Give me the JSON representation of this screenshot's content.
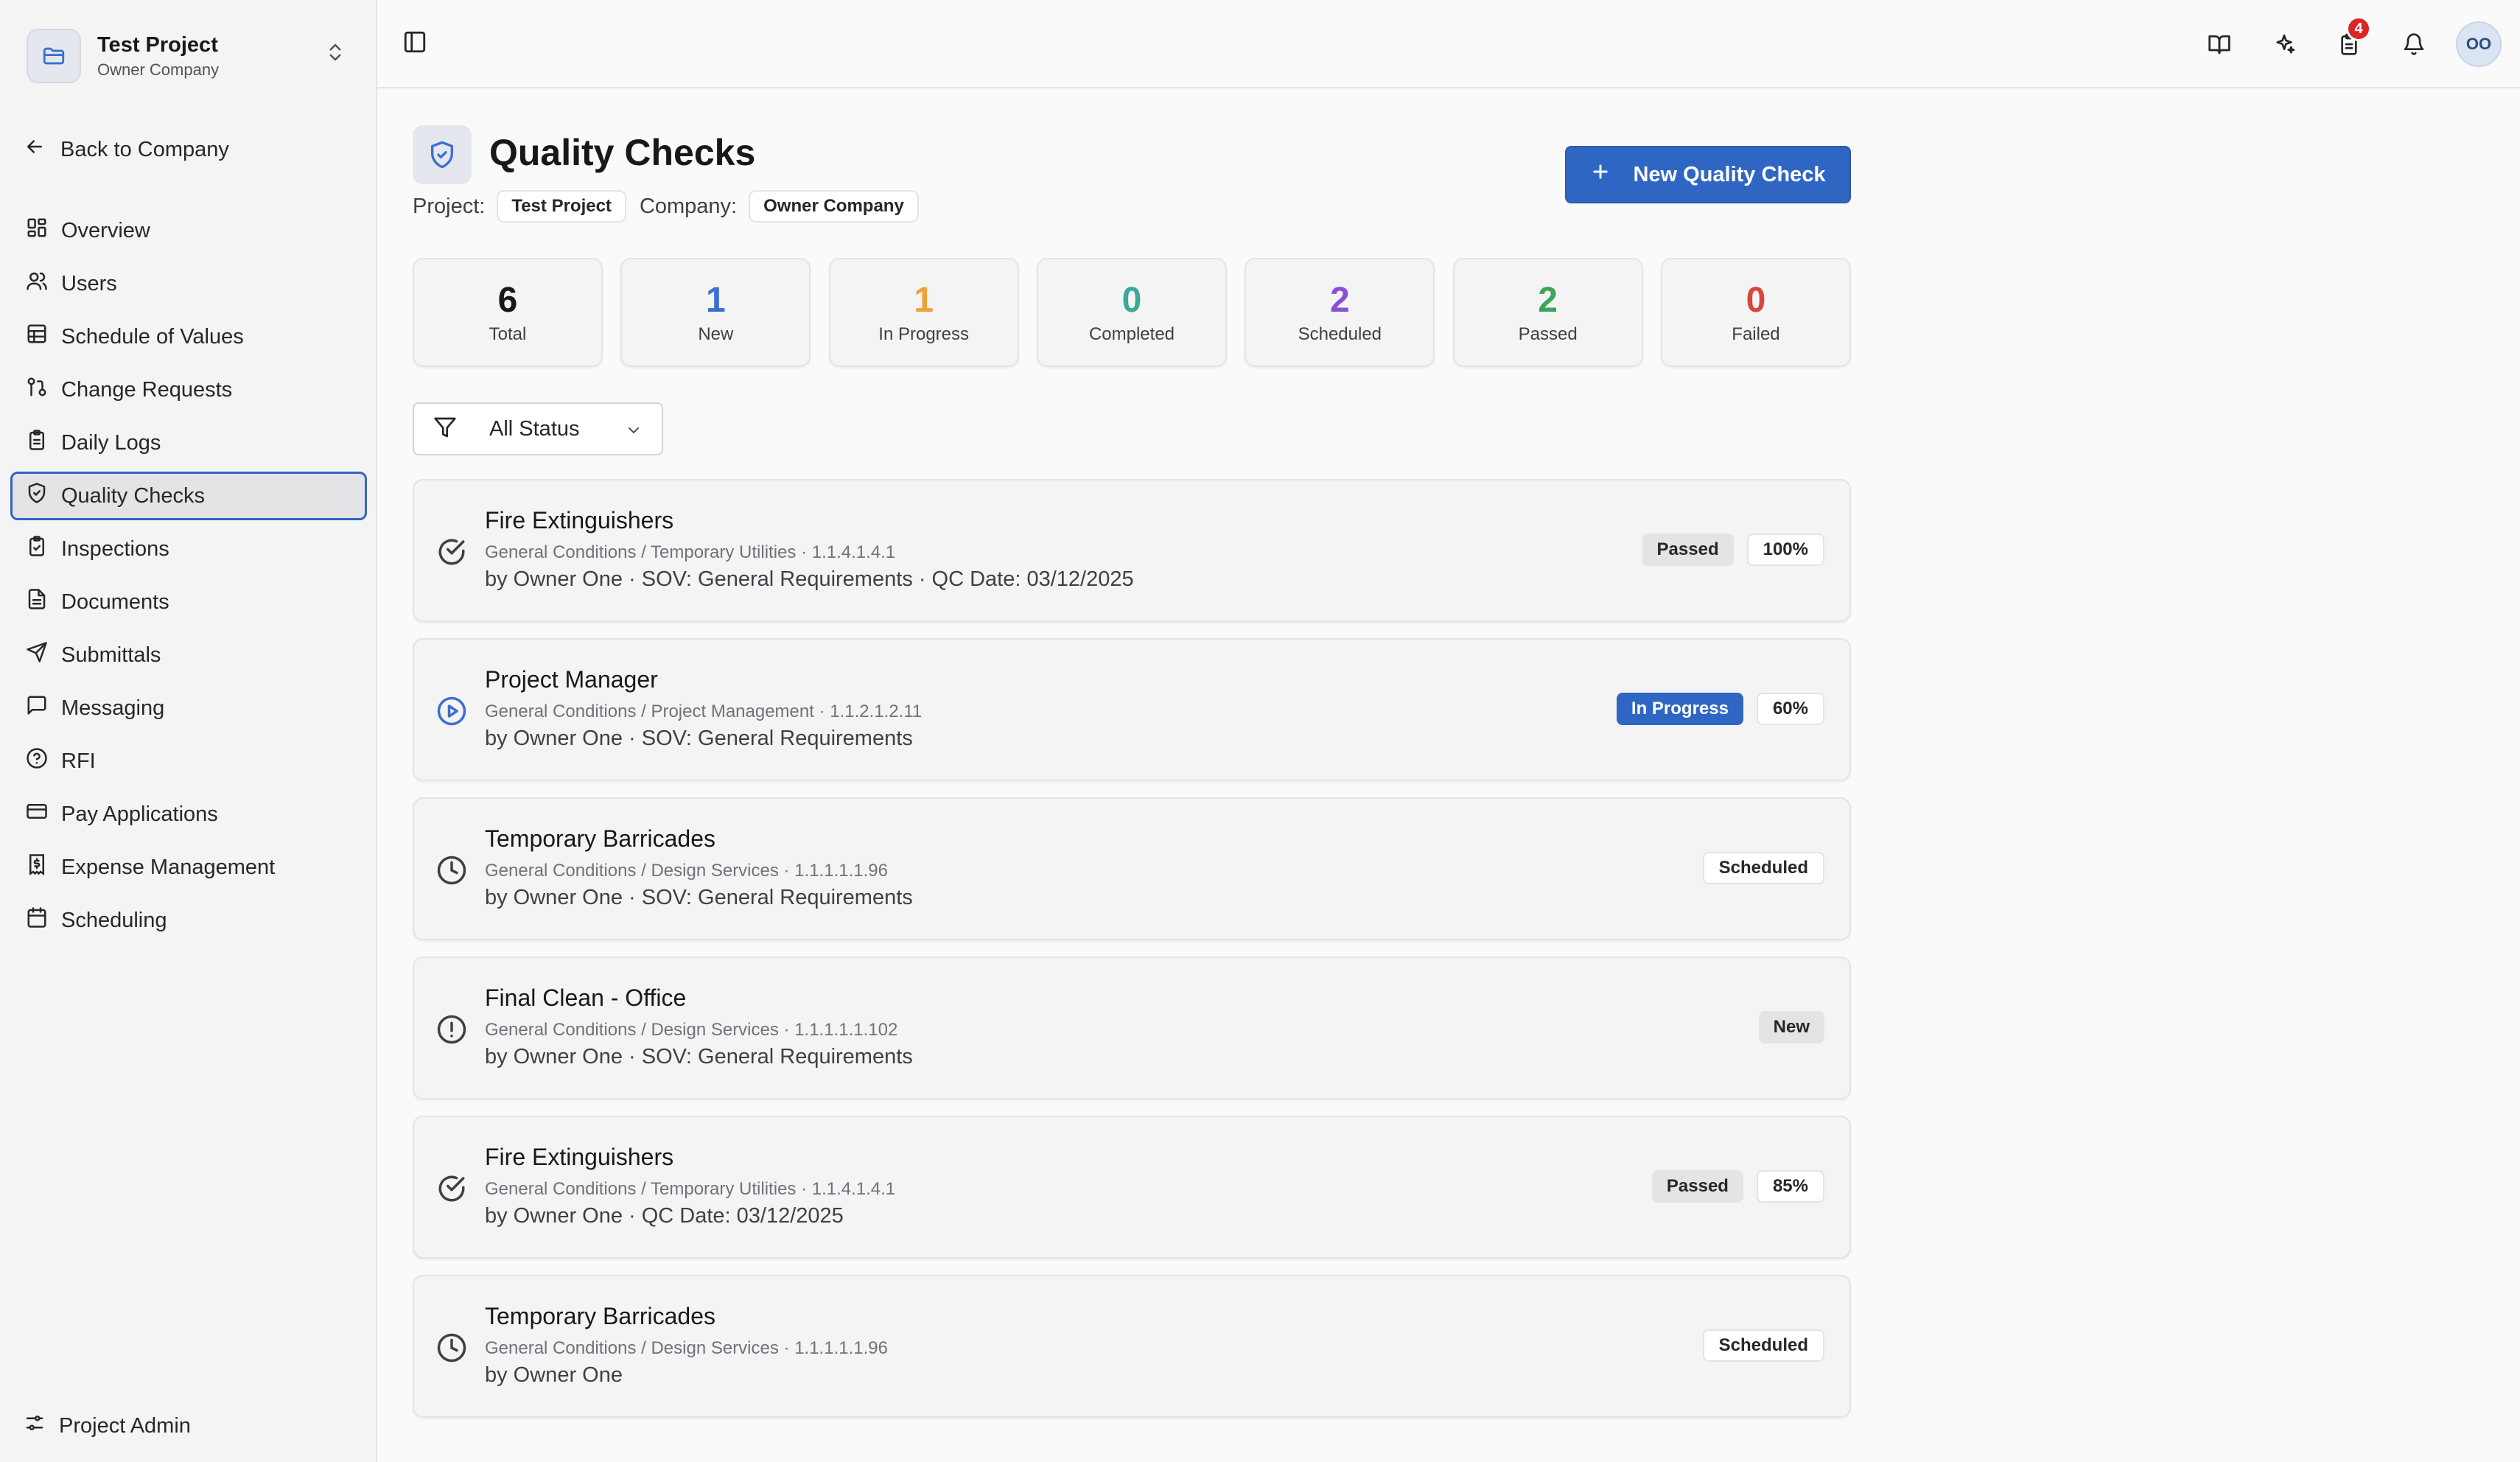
{
  "project": {
    "name": "Test Project",
    "company": "Owner Company"
  },
  "sidebar": {
    "back_label": "Back to Company",
    "items": [
      {
        "label": "Overview",
        "icon": "grid-icon"
      },
      {
        "label": "Users",
        "icon": "users-icon"
      },
      {
        "label": "Schedule of Values",
        "icon": "table-icon"
      },
      {
        "label": "Change Requests",
        "icon": "git-pull-icon"
      },
      {
        "label": "Daily Logs",
        "icon": "clipboard-icon"
      },
      {
        "label": "Quality Checks",
        "icon": "shield-check-icon",
        "active": true
      },
      {
        "label": "Inspections",
        "icon": "clipboard-check-icon"
      },
      {
        "label": "Documents",
        "icon": "file-icon"
      },
      {
        "label": "Submittals",
        "icon": "send-icon"
      },
      {
        "label": "Messaging",
        "icon": "message-icon"
      },
      {
        "label": "RFI",
        "icon": "help-circle-icon"
      },
      {
        "label": "Pay Applications",
        "icon": "credit-card-icon"
      },
      {
        "label": "Expense Management",
        "icon": "receipt-icon"
      },
      {
        "label": "Scheduling",
        "icon": "calendar-icon"
      }
    ],
    "admin_label": "Project Admin"
  },
  "header": {
    "tasks_badge": "4",
    "avatar_initials": "OO"
  },
  "page": {
    "title": "Quality Checks",
    "project_label": "Project:",
    "project_value": "Test Project",
    "company_label": "Company:",
    "company_value": "Owner Company",
    "new_button": "New Quality Check"
  },
  "stats": [
    {
      "value": "6",
      "label": "Total",
      "color": "#18181b"
    },
    {
      "value": "1",
      "label": "New",
      "color": "#3b6fd0"
    },
    {
      "value": "1",
      "label": "In Progress",
      "color": "#f0a03a"
    },
    {
      "value": "0",
      "label": "Completed",
      "color": "#3aa89a"
    },
    {
      "value": "2",
      "label": "Scheduled",
      "color": "#8b4fd6"
    },
    {
      "value": "2",
      "label": "Passed",
      "color": "#3ea45a"
    },
    {
      "value": "0",
      "label": "Failed",
      "color": "#d9443b"
    }
  ],
  "filter": {
    "value": "All Status"
  },
  "checks": [
    {
      "title": "Fire Extinguishers",
      "path": "General Conditions / Temporary Utilities · 1.1.4.1.4.1",
      "by": "by Owner One · SOV: General Requirements · QC Date: 03/12/2025",
      "status": "Passed",
      "status_kind": "passed",
      "percent": "100%",
      "icon": "check-circle-icon"
    },
    {
      "title": "Project Manager",
      "path": "General Conditions / Project Management · 1.1.2.1.2.11",
      "by": "by Owner One · SOV: General Requirements",
      "status": "In Progress",
      "status_kind": "progress",
      "percent": "60%",
      "icon": "play-circle-icon"
    },
    {
      "title": "Temporary Barricades",
      "path": "General Conditions / Design Services · 1.1.1.1.1.96",
      "by": "by Owner One · SOV: General Requirements",
      "status": "Scheduled",
      "status_kind": "scheduled",
      "percent": null,
      "icon": "clock-icon"
    },
    {
      "title": "Final Clean - Office",
      "path": "General Conditions / Design Services · 1.1.1.1.1.102",
      "by": "by Owner One · SOV: General Requirements",
      "status": "New",
      "status_kind": "new",
      "percent": null,
      "icon": "alert-circle-icon"
    },
    {
      "title": "Fire Extinguishers",
      "path": "General Conditions / Temporary Utilities · 1.1.4.1.4.1",
      "by": "by Owner One · QC Date: 03/12/2025",
      "status": "Passed",
      "status_kind": "passed",
      "percent": "85%",
      "icon": "check-circle-icon"
    },
    {
      "title": "Temporary Barricades",
      "path": "General Conditions / Design Services · 1.1.1.1.1.96",
      "by": "by Owner One",
      "status": "Scheduled",
      "status_kind": "scheduled",
      "percent": null,
      "icon": "clock-icon"
    }
  ]
}
